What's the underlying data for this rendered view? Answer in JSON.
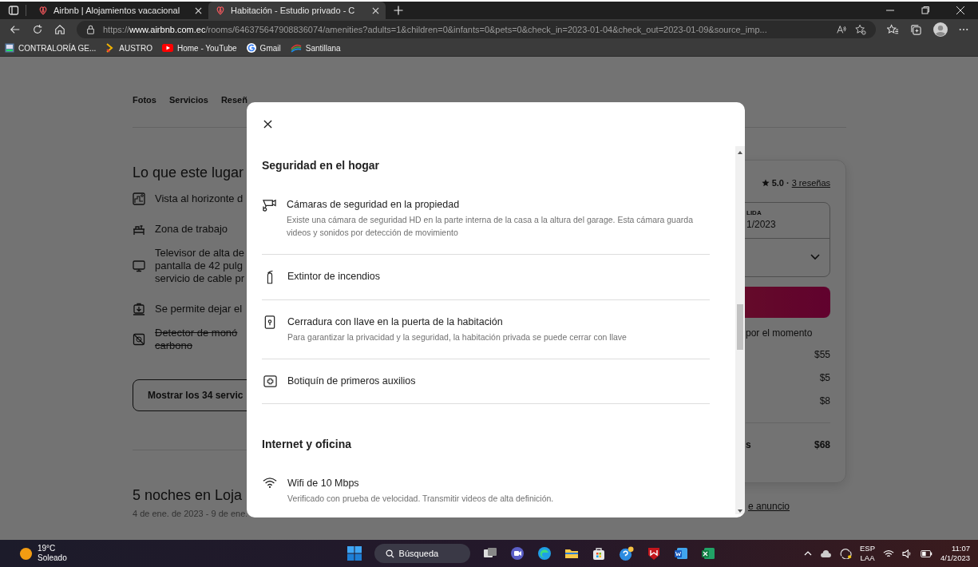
{
  "browser": {
    "tabs": [
      {
        "title": "Airbnb | Alojamientos vacacional",
        "selected": false
      },
      {
        "title": "Habitación - Estudio privado - C",
        "selected": true
      }
    ],
    "address": {
      "scheme": "https://",
      "host": "www.airbnb.com.ec",
      "path": "/rooms/646375647908836074/amenities?adults=1&children=0&infants=0&pets=0&check_in=2023-01-04&check_out=2023-01-09&source_imp..."
    },
    "bookmarks": [
      "CONTRALORÍA GE...",
      "AUSTRO",
      "Home - YouTube",
      "Gmail",
      "Santillana"
    ]
  },
  "page": {
    "nav": [
      "Fotos",
      "Servicios",
      "Reseñ"
    ],
    "amenities_heading": "Lo que este lugar",
    "amenities": [
      {
        "lines": [
          "Vista al horizonte d"
        ],
        "available": true
      },
      {
        "lines": [
          "Zona de trabajo"
        ],
        "available": true
      },
      {
        "lines": [
          "Televisor de alta de",
          "pantalla de 42 pulg",
          "servicio de cable pr"
        ],
        "available": true
      },
      {
        "lines": [
          "Se permite dejar el"
        ],
        "available": true
      },
      {
        "lines": [
          "Detector de monó",
          "carbono"
        ],
        "available": false
      }
    ],
    "show_all_button": "Mostrar los 34 servic",
    "trip_title": "5 noches en Loja",
    "trip_dates": "4 de ene. de 2023 - 9 de ene.",
    "booking": {
      "rating": "5.0",
      "separator": "·",
      "reviews": "3 reseñas",
      "checkout_label": "LIDA",
      "checkout_value": "1/2023",
      "notice": "por el momento",
      "prices": [
        "$55",
        "$5",
        "$8"
      ],
      "total_label": "s",
      "total": "$68"
    },
    "report_link": "e anuncio"
  },
  "modal": {
    "sections": [
      {
        "heading": "Seguridad en el hogar",
        "items": [
          {
            "title": "Cámaras de seguridad en la propiedad",
            "description": "Existe una cámara de seguridad HD en la parte interna de la casa a la altura del garage. Esta cámara guarda videos y sonidos por detección de movimiento"
          },
          {
            "title": "Extintor de incendios"
          },
          {
            "title": "Cerradura con llave en la puerta de la habitación",
            "description": "Para garantizar la privacidad y la seguridad, la habitación privada se puede cerrar con llave"
          },
          {
            "title": "Botiquín de primeros auxilios"
          }
        ]
      },
      {
        "heading": "Internet y oficina",
        "items": [
          {
            "title": "Wifi de 10 Mbps",
            "description": "Verificado con prueba de velocidad. Transmitir videos de alta definición."
          }
        ]
      }
    ]
  },
  "taskbar": {
    "temperature": "19°C",
    "condition": "Soleado",
    "search": "Búsqueda",
    "language": "ESP",
    "layout": "LAA",
    "time": "11:07",
    "date": "4/1/2023"
  }
}
